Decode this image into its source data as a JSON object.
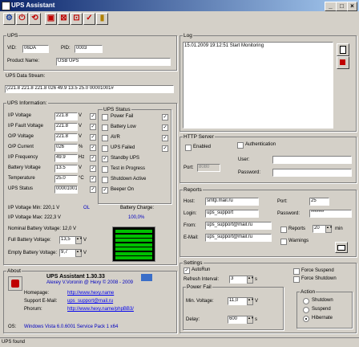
{
  "window": {
    "title": "UPS Assistant",
    "min": "_",
    "max": "□",
    "close": "×"
  },
  "toolbar": {
    "icons": [
      "settings-icon",
      "power-icon",
      "refresh-icon",
      "monitor-icon",
      "shutdown-icon",
      "info-icon"
    ]
  },
  "ups": {
    "group": "UPS",
    "vid_label": "VID:",
    "vid": "06DA",
    "pid_label": "PID:",
    "pid": "0003",
    "product_label": "Product Name:",
    "product": "USB UPS"
  },
  "datastream": {
    "label": "UPS Data Stream:",
    "value": "(221.8 221.8 221.8 026 49.9 13.5 25.0 00001001#"
  },
  "info": {
    "group": "UPS Information:",
    "rows": [
      {
        "label": "I/P Voltage",
        "value": "221.8",
        "unit": "V"
      },
      {
        "label": "I/P Fault Voltage",
        "value": "221.8",
        "unit": "V"
      },
      {
        "label": "O/P Voltage",
        "value": "221.8",
        "unit": "V"
      },
      {
        "label": "O/P Current",
        "value": "026",
        "unit": "%"
      },
      {
        "label": "I/P Frequency",
        "value": "49.9",
        "unit": "Hz"
      },
      {
        "label": "Battery Voltage",
        "value": "13.5",
        "unit": "V"
      },
      {
        "label": "Temperature",
        "value": "25.0",
        "unit": "°C"
      },
      {
        "label": "UPS Status",
        "value": "00001001",
        "unit": ""
      }
    ],
    "ipmin": "I/P Voltage Min:  220,1   V",
    "ipmax": "I/P Voltage Max:  222,3   V",
    "ol": "OL",
    "charge_label": "Battery Charge:",
    "charge_value": "100,0%",
    "charge_fraction": 1.0,
    "nominal": "Nominal Battery Voltage:  12,0  V",
    "full_label": "Full Battery Voltage:",
    "full": "13,5",
    "empty_label": "Empty Battery Voltage:",
    "empty": "9,7",
    "v": "V"
  },
  "status": {
    "group": "UPS Status",
    "items": [
      {
        "label": "Power Fail",
        "checked": false
      },
      {
        "label": "Battery Low",
        "checked": false
      },
      {
        "label": "AVR",
        "checked": false
      },
      {
        "label": "UPS Failed",
        "checked": false
      },
      {
        "label": "Standby UPS",
        "checked": true
      },
      {
        "label": "Test in Progress",
        "checked": false
      },
      {
        "label": "Shutdown Active",
        "checked": false
      },
      {
        "label": "Beeper On",
        "checked": true
      }
    ]
  },
  "about": {
    "group": "About",
    "name": "UPS Assistant 1.30.33",
    "author": "Alexey V.Voronin @ Hexy  © 2008 - 2009",
    "homepage_label": "Homepage:",
    "homepage": "http://www.hexy.name",
    "support_label": "Support E-Mail:",
    "support": "ups_support@mail.ru",
    "phorum_label": "Phorum:",
    "phorum": "http://www.hexy.name/phpBB3/",
    "os_label": "OS:",
    "os": "Windows Vista 6.0.6001 Service Pack 1 x64"
  },
  "log": {
    "group": "Log",
    "entries": [
      "15.01.2009 19:12:51 Start Monitoring"
    ]
  },
  "http": {
    "group": "HTTP Server",
    "enabled_label": "Enabled",
    "auth_label": "Authentication",
    "port_label": "Port:",
    "port": "8080",
    "user_label": "User:",
    "user": "",
    "pass_label": "Password:",
    "pass": ""
  },
  "reports": {
    "group": "Reports",
    "host_label": "Host:",
    "host": "smtp.mail.ru",
    "port_label": "Port:",
    "port": "25",
    "login_label": "Login:",
    "login": "ups_support",
    "pass_label": "Password:",
    "pass": "*******",
    "from_label": "From:",
    "from": "ups_support@mail.ru",
    "to_label": "E-Mail:",
    "to": "ups_support@mail.ru",
    "reports_label": "Reports",
    "reports_val": "20",
    "min": "min",
    "warnings_label": "Warnings"
  },
  "settings": {
    "group": "Settings",
    "autorun": "AutoRun",
    "refresh_label": "Refresh Interval:",
    "refresh": "3",
    "s": "s",
    "force_suspend": "Force Suspend",
    "force_shutdown": "Force Shutdown",
    "powerfail_group": "Power Fail",
    "minv_label": "Min. Voltage:",
    "minv": "11,0",
    "v": "V",
    "delay_label": "Delay:",
    "delay": "600",
    "s2": "s",
    "action_group": "Action",
    "actions": [
      {
        "label": "Shutdown",
        "on": false
      },
      {
        "label": "Suspend",
        "on": false
      },
      {
        "label": "Hibernate",
        "on": true
      }
    ]
  },
  "statusbar": {
    "text": "UPS found"
  }
}
